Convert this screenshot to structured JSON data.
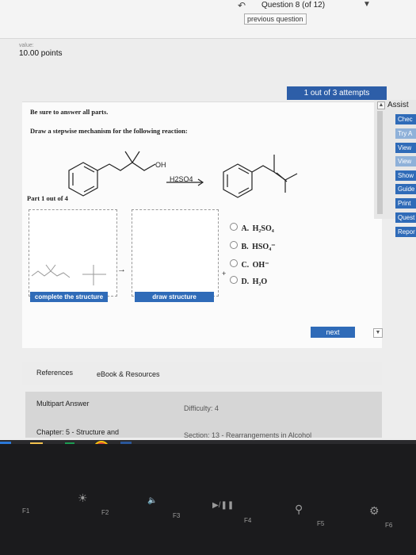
{
  "header": {
    "question": "Question 8 (of 12)",
    "previous_button": "previous question",
    "back_icon": "back-arrow-icon",
    "dropdown_icon": "chevron-down-icon"
  },
  "score": {
    "label": "value:",
    "points": "10.00 points"
  },
  "attempts": "1 out of 3 attempts",
  "content": {
    "instruction": "Be sure to answer all parts.",
    "prompt": "Draw a stepwise mechanism for the following reaction:",
    "oh_label": "OH",
    "reagent": "H2SO4",
    "part_label": "Part 1 out of 4",
    "complete_button": "complete the structure",
    "draw_button": "draw structure",
    "plus": "+"
  },
  "options": [
    {
      "letter": "A.",
      "text": "H₂SO₄"
    },
    {
      "letter": "B.",
      "text": "HSO₄⁻"
    },
    {
      "letter": "C.",
      "text": "OH⁻"
    },
    {
      "letter": "D.",
      "text": "H₂O"
    }
  ],
  "sidebar": {
    "title": "Assist",
    "items": [
      "Chec",
      "Try A",
      "View",
      "View",
      "Show",
      "Guide",
      "Print",
      "Quest",
      "Repor"
    ]
  },
  "next_button": "next",
  "footer": {
    "references": "References",
    "ebook": "eBook & Resources",
    "multipart": "Multipart Answer",
    "difficulty": "Difficulty: 4",
    "chapter": "Chapter: 5 - Structure and",
    "section": "Section: 13 - Rearrangements in Alcohol"
  },
  "keyboard": [
    "F1",
    "F2",
    "F3",
    "F4",
    "F5",
    "F6"
  ],
  "colors": {
    "accent": "#2f6bb8",
    "attempts": "#2d5ea8"
  }
}
